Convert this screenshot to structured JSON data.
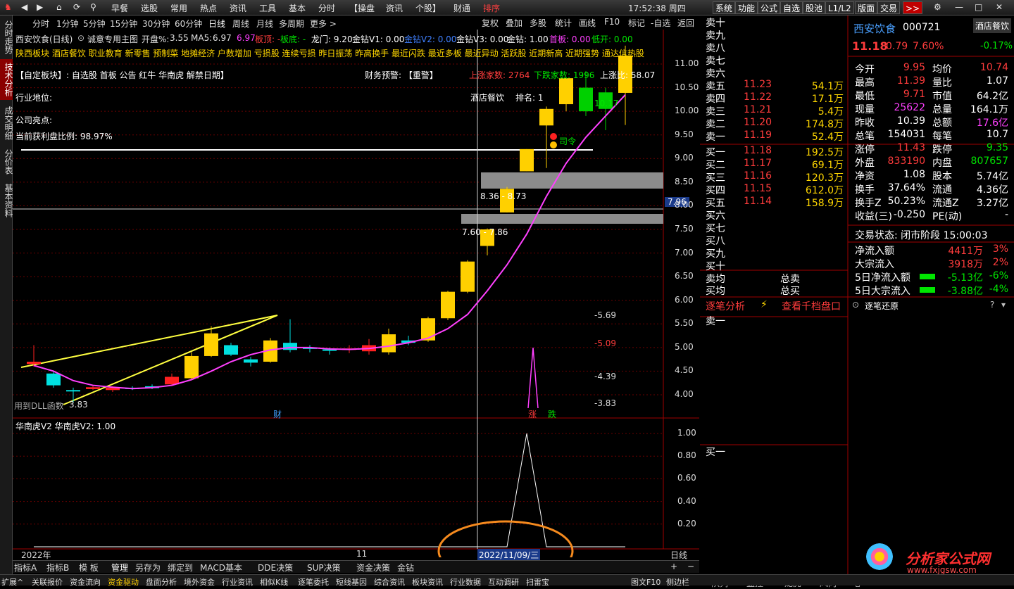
{
  "topbar": {
    "menus": [
      "分时",
      "1分钟",
      "5分钟",
      "15分钟"
    ],
    "main_menu": [
      "早餐",
      "选股",
      "常用",
      "热点",
      "资讯",
      "工具",
      "基本",
      "分时",
      "【操盘",
      "资讯",
      "个股】",
      "财通",
      "排序"
    ],
    "clock": "17:52:38 周四",
    "right_buttons": [
      "系统",
      "功能",
      "公式",
      "自选",
      "股池",
      "L1/L2",
      "版面",
      "交易",
      ">>"
    ]
  },
  "left_tabs": [
    "分时走势",
    "技术分析",
    "成交明细",
    "分价表",
    "基本资料"
  ],
  "period_bar": [
    "分时",
    "1分钟",
    "5分钟",
    "15分钟",
    "30分钟",
    "60分钟",
    "日线",
    "周线",
    "月线",
    "多周期",
    "更多 >"
  ],
  "toolbar2": [
    "复权",
    "叠加",
    "多股",
    "统计",
    "画线",
    "F10",
    "标记",
    "-自选",
    "返回"
  ],
  "chart_header": {
    "title": "西安饮食(日线)",
    "indicator": "诚意专用主图",
    "open_pct_label": "开盘%:",
    "open_pct": "3.55",
    "ma5_label": "MA5:",
    "ma5": "6.97",
    "v6": "6.97",
    "board_top": "板顶: -",
    "board_bottom": "板底: -",
    "dragon_gate": "龙门: 9.20",
    "drill1": "金钻V1: 0.00",
    "drill2": "金钻V2: 0.00",
    "drill3": "金钻V3: 0.00",
    "drill": "金钻: 1.00",
    "first_board": "首板: 0.00",
    "low_open": "低开: 0.00",
    "tags_line": "陕西板块 酒店餐饮 职业教育 新零售 预制菜 地摊经济 户数增加 亏损股 连续亏损 昨日振荡 昨高换手 最近闪跌 最近多板 最近异动 活跃股 近期新高 近期强势 通达信热股",
    "custom_board": "【自定板块】: 自选股 首板 公告 红牛 华南虎 解禁日期】",
    "fin_warning": "财务预警: 【重警】",
    "up_count": "上涨家数: 2764",
    "down_count": "下跌家数: 1996",
    "up_ratio": "上涨比: 58.07",
    "industry": "行业地位:",
    "industry_name": "酒店餐饮",
    "rank": "排名: 1",
    "highlight": "公司亮点:",
    "profit_ratio": "当前获利盘比例: 98.97%",
    "dll_label": "用到DLL函数",
    "low_label": "3.83",
    "gap1": "8.36 - 8.73",
    "gap2": "7.60 - 7.86",
    "price_tag": "10.17",
    "current_price_axis": "7.96",
    "bottom_label_cai": "财",
    "bottom_label_zhang": "涨",
    "bottom_label_die": "跌",
    "signal_label": "司令",
    "levels": [
      "-5.69",
      "-5.09",
      "-4.39",
      "-3.83"
    ]
  },
  "y_axis_main": [
    "11.00",
    "10.50",
    "10.00",
    "9.50",
    "9.00",
    "8.50",
    "8.00",
    "7.50",
    "7.00",
    "6.50",
    "6.00",
    "5.50",
    "5.00",
    "4.50",
    "4.00"
  ],
  "sub_indicator": {
    "title": "华南虎V2  华南虎V2: 1.00",
    "y_axis": [
      "1.00",
      "0.80",
      "0.60",
      "0.40",
      "0.20"
    ]
  },
  "x_axis": {
    "year": "2022年",
    "month": "11",
    "cursor_date": "2022/11/09/三",
    "period": "日线"
  },
  "chart_data": {
    "type": "candlestick",
    "candles": [
      {
        "o": 4.65,
        "c": 4.7,
        "h": 5.05,
        "l": 4.6
      },
      {
        "o": 4.45,
        "c": 4.2,
        "h": 4.5,
        "l": 4.15
      },
      {
        "o": 4.1,
        "c": 4.08,
        "h": 4.15,
        "l": 3.83
      },
      {
        "o": 4.12,
        "c": 4.16,
        "h": 4.2,
        "l": 4.1
      },
      {
        "o": 4.1,
        "c": 4.15,
        "h": 4.18,
        "l": 4.06
      },
      {
        "o": 4.15,
        "c": 4.12,
        "h": 4.18,
        "l": 4.1
      },
      {
        "o": 4.18,
        "c": 4.14,
        "h": 4.22,
        "l": 4.12
      },
      {
        "o": 4.22,
        "c": 4.38,
        "h": 4.45,
        "l": 4.2
      },
      {
        "o": 4.35,
        "c": 4.82,
        "h": 4.9,
        "l": 4.32
      },
      {
        "o": 4.82,
        "c": 5.3,
        "h": 5.45,
        "l": 4.8
      },
      {
        "o": 5.05,
        "c": 4.85,
        "h": 5.1,
        "l": 4.82
      },
      {
        "o": 4.75,
        "c": 4.68,
        "h": 4.8,
        "l": 4.6
      },
      {
        "o": 4.7,
        "c": 5.15,
        "h": 5.2,
        "l": 4.68
      },
      {
        "o": 5.1,
        "c": 4.95,
        "h": 5.6,
        "l": 4.9
      },
      {
        "o": 5.0,
        "c": 4.98,
        "h": 5.05,
        "l": 4.9
      },
      {
        "o": 4.96,
        "c": 4.95,
        "h": 5.0,
        "l": 4.85
      },
      {
        "o": 4.95,
        "c": 4.98,
        "h": 5.05,
        "l": 4.88
      },
      {
        "o": 4.92,
        "c": 5.05,
        "h": 5.18,
        "l": 4.85
      },
      {
        "o": 4.9,
        "c": 5.28,
        "h": 5.4,
        "l": 4.85
      },
      {
        "o": 5.15,
        "c": 5.1,
        "h": 5.25,
        "l": 5.05
      },
      {
        "o": 5.15,
        "c": 5.62,
        "h": 5.65,
        "l": 5.12
      },
      {
        "o": 5.62,
        "c": 6.18,
        "h": 6.2,
        "l": 5.58
      },
      {
        "o": 6.18,
        "c": 6.82,
        "h": 6.85,
        "l": 6.15
      },
      {
        "o": 7.15,
        "c": 7.5,
        "h": 7.52,
        "l": 6.95
      },
      {
        "o": 7.86,
        "c": 8.36,
        "h": 8.4,
        "l": 7.86
      },
      {
        "o": 8.73,
        "c": 9.2,
        "h": 9.2,
        "l": 8.73
      },
      {
        "o": 9.7,
        "c": 10.05,
        "h": 10.1,
        "l": 8.8
      },
      {
        "o": 10.15,
        "c": 10.7,
        "h": 10.72,
        "l": 10.0
      },
      {
        "o": 10.5,
        "c": 10.0,
        "h": 10.85,
        "l": 9.9
      },
      {
        "o": 10.4,
        "c": 10.05,
        "h": 10.5,
        "l": 9.6
      },
      {
        "o": 10.39,
        "c": 11.18,
        "h": 11.39,
        "l": 9.71
      }
    ],
    "ma5": [
      4.62,
      4.5,
      4.3,
      4.2,
      4.16,
      4.13,
      4.15,
      4.2,
      4.32,
      4.5,
      4.7,
      4.85,
      4.95,
      5.0,
      5.0,
      4.97,
      4.96,
      4.98,
      5.03,
      5.1,
      5.2,
      5.4,
      5.7,
      6.2,
      6.75,
      7.4,
      8.2,
      8.9,
      9.45,
      9.9,
      10.35
    ],
    "ylim": [
      3.6,
      11.3
    ],
    "sub_indicator": [
      0,
      0,
      0,
      0,
      0,
      0,
      0,
      0,
      0,
      0,
      0,
      0,
      0,
      0,
      0,
      0,
      0,
      0,
      0,
      0,
      0,
      0,
      0,
      0,
      0,
      1,
      0,
      0,
      0,
      0,
      0
    ],
    "sub_ylim": [
      0,
      1.05
    ]
  },
  "stock": {
    "name": "西安饮食",
    "code": "000721",
    "sector": "酒店餐饮",
    "price": "11.18",
    "change": "0.79",
    "pct": "7.60%",
    "sector_pct": "-0.17%"
  },
  "order_book": {
    "sell_empty": [
      "卖十",
      "卖九",
      "卖八",
      "卖七",
      "卖六"
    ],
    "sells": [
      {
        "label": "卖五",
        "price": "11.23",
        "vol": "54.1万"
      },
      {
        "label": "卖四",
        "price": "11.22",
        "vol": "17.1万"
      },
      {
        "label": "卖三",
        "price": "11.21",
        "vol": "5.4万"
      },
      {
        "label": "卖二",
        "price": "11.20",
        "vol": "174.8万"
      },
      {
        "label": "卖一",
        "price": "11.19",
        "vol": "52.4万"
      }
    ],
    "buys": [
      {
        "label": "买一",
        "price": "11.18",
        "vol": "192.5万"
      },
      {
        "label": "买二",
        "price": "11.17",
        "vol": "69.1万"
      },
      {
        "label": "买三",
        "price": "11.16",
        "vol": "120.3万"
      },
      {
        "label": "买四",
        "price": "11.15",
        "vol": "612.0万"
      },
      {
        "label": "买五",
        "price": "11.14",
        "vol": "158.9万"
      }
    ],
    "buy_empty": [
      "买六",
      "买七",
      "买八",
      "买九",
      "买十"
    ],
    "avg_sell": "卖均",
    "avg_buy": "买均",
    "total_sell": "总卖",
    "total_buy": "总买",
    "tick_analysis": "逐笔分析",
    "thousand_book": "查看千档盘口",
    "sell_one": "卖一",
    "buy_one": "买一"
  },
  "quote": {
    "rows": [
      [
        "今开",
        "9.95",
        "均价",
        "10.74"
      ],
      [
        "最高",
        "11.39",
        "量比",
        "1.07"
      ],
      [
        "最低",
        "9.71",
        "市值",
        "64.2亿"
      ],
      [
        "现量",
        "25622",
        "总量",
        "164.1万"
      ],
      [
        "昨收",
        "10.39",
        "总额",
        "17.6亿"
      ],
      [
        "总笔",
        "154031",
        "每笔",
        "10.7"
      ],
      [
        "涨停",
        "11.43",
        "跌停",
        "9.35"
      ],
      [
        "外盘",
        "833190",
        "内盘",
        "807657"
      ],
      [
        "净资",
        "1.08",
        "股本",
        "5.74亿"
      ],
      [
        "换手",
        "37.64%",
        "流通",
        "4.36亿"
      ],
      [
        "换手Z",
        "50.23%",
        "流通Z",
        "3.27亿"
      ],
      [
        "收益(三)",
        "-0.250",
        "PE(动)",
        "-"
      ]
    ],
    "trade_status": "交易状态: 闭市阶段 15:00:03",
    "flows": [
      {
        "label": "净流入额",
        "value": "4411万",
        "pct": "3%"
      },
      {
        "label": "大宗流入",
        "value": "3918万",
        "pct": "2%"
      },
      {
        "label": "5日净流入额",
        "value": "-5.13亿",
        "pct": "-6%"
      },
      {
        "label": "5日大宗流入",
        "value": "-3.88亿",
        "pct": "-4%"
      }
    ],
    "tick_restore": "逐笔还原"
  },
  "bottom_bar1": [
    "指标A",
    "指标B",
    "模 板",
    "管理",
    "另存为",
    "绑定到",
    "MACD基本",
    "DDE决策",
    "SUP决策",
    "资金决策",
    "金钻"
  ],
  "bottom_bar2": [
    "扩展^",
    "关联报价",
    "资金流向",
    "资金驱动",
    "盘面分析",
    "境外资金",
    "行业资讯",
    "相似K线",
    "逐笔委托",
    "短线基因",
    "综合资讯",
    "板块资讯",
    "行业数据",
    "互动调研",
    "扫雷宝",
    "图文F10",
    "侧边栏"
  ],
  "bottom_tabs_right": [
    "队列",
    "监控",
    "龙虎",
    "风向",
    "笔"
  ],
  "watermark": {
    "title": "分析家公式网",
    "url": "www.fxjgsw.com"
  }
}
